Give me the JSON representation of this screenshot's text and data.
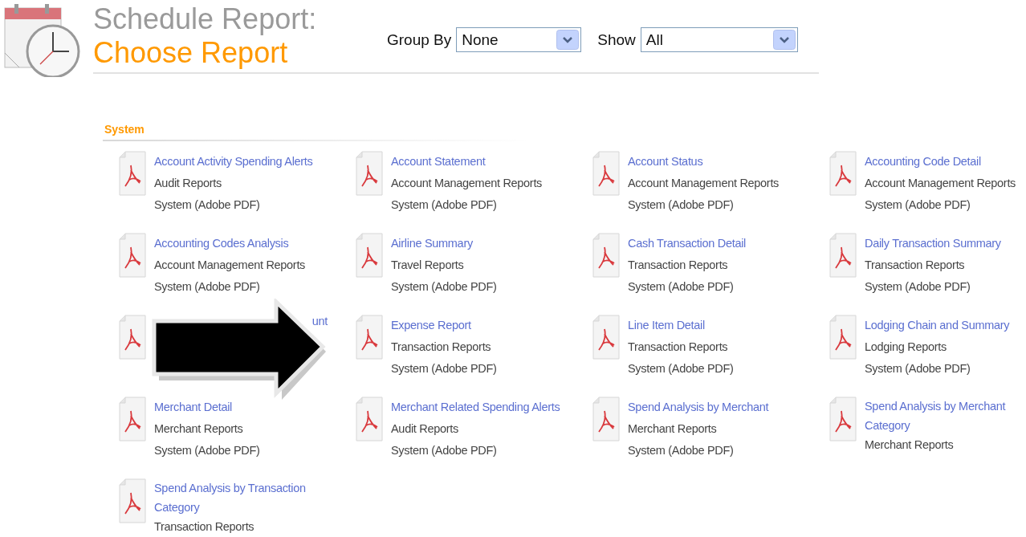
{
  "header": {
    "title": "Schedule Report:",
    "subtitle": "Choose Report"
  },
  "filters": [
    {
      "label": "Group By",
      "value": "None"
    },
    {
      "label": "Show",
      "value": "All"
    }
  ],
  "section": {
    "title": "System",
    "reports": [
      {
        "title": "Account Activity Spending Alerts",
        "category": "Audit Reports",
        "type": "System (Adobe PDF)"
      },
      {
        "title": "Account Statement",
        "category": "Account Management Reports",
        "type": "System (Adobe PDF)"
      },
      {
        "title": "Account Status",
        "category": "Account Management Reports",
        "type": "System (Adobe PDF)"
      },
      {
        "title": "Accounting Code Detail",
        "category": "Account Management Reports",
        "type": "System (Adobe PDF)"
      },
      {
        "title": "Accounting Codes Analysis",
        "category": "Account Management Reports",
        "type": "System (Adobe PDF)"
      },
      {
        "title": "Airline Summary",
        "category": "Travel Reports",
        "type": "System (Adobe PDF)"
      },
      {
        "title": "Cash Transaction Detail",
        "category": "Transaction Reports",
        "type": "System (Adobe PDF)"
      },
      {
        "title": "Daily Transaction Summary",
        "category": "Transaction Reports",
        "type": "System (Adobe PDF)"
      },
      {
        "title": "unt",
        "obscured": true
      },
      {
        "title": "Expense Report",
        "category": "Transaction Reports",
        "type": "System (Adobe PDF)"
      },
      {
        "title": "Line Item Detail",
        "category": "Transaction Reports",
        "type": "System (Adobe PDF)"
      },
      {
        "title": "Lodging Chain and Summary",
        "category": "Lodging Reports",
        "type": "System (Adobe PDF)"
      },
      {
        "title": "Merchant Detail",
        "category": "Merchant Reports",
        "type": "System (Adobe PDF)"
      },
      {
        "title": "Merchant Related Spending Alerts",
        "category": "Audit Reports",
        "type": "System (Adobe PDF)"
      },
      {
        "title": "Spend Analysis by Merchant",
        "category": "Merchant Reports",
        "type": "System (Adobe PDF)"
      },
      {
        "title": "Spend Analysis by Merchant Category",
        "category": "Merchant Reports"
      },
      {
        "title": "Spend Analysis by Transaction Category",
        "category": "Transaction Reports"
      }
    ]
  },
  "overlay": {
    "kind": "arrow"
  }
}
